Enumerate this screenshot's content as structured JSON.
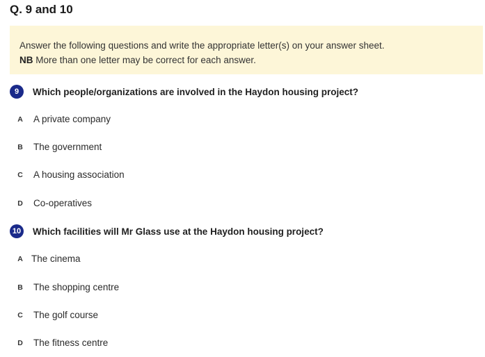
{
  "header": {
    "title": "Q. 9 and 10"
  },
  "instructions": {
    "line1": "Answer the following questions and write the appropriate letter(s) on your answer sheet.",
    "nb_label": "NB",
    "line2": "More than one letter may be correct for each answer."
  },
  "questions": [
    {
      "number": "9",
      "text": "Which people/organizations are involved in the Haydon housing project?",
      "options": [
        {
          "letter": "A",
          "text": "A private company"
        },
        {
          "letter": "B",
          "text": "The government"
        },
        {
          "letter": "C",
          "text": "A housing association"
        },
        {
          "letter": "D",
          "text": "Co-operatives"
        }
      ]
    },
    {
      "number": "10",
      "text": "Which facilities will Mr Glass use at the Haydon housing project?",
      "options": [
        {
          "letter": "A",
          "text": "The cinema"
        },
        {
          "letter": "B",
          "text": "The shopping centre"
        },
        {
          "letter": "C",
          "text": "The golf course"
        },
        {
          "letter": "D",
          "text": "The fitness centre"
        }
      ]
    }
  ],
  "colors": {
    "badge": "#1a2a8a",
    "instructions_bg": "#fdf6d8"
  }
}
